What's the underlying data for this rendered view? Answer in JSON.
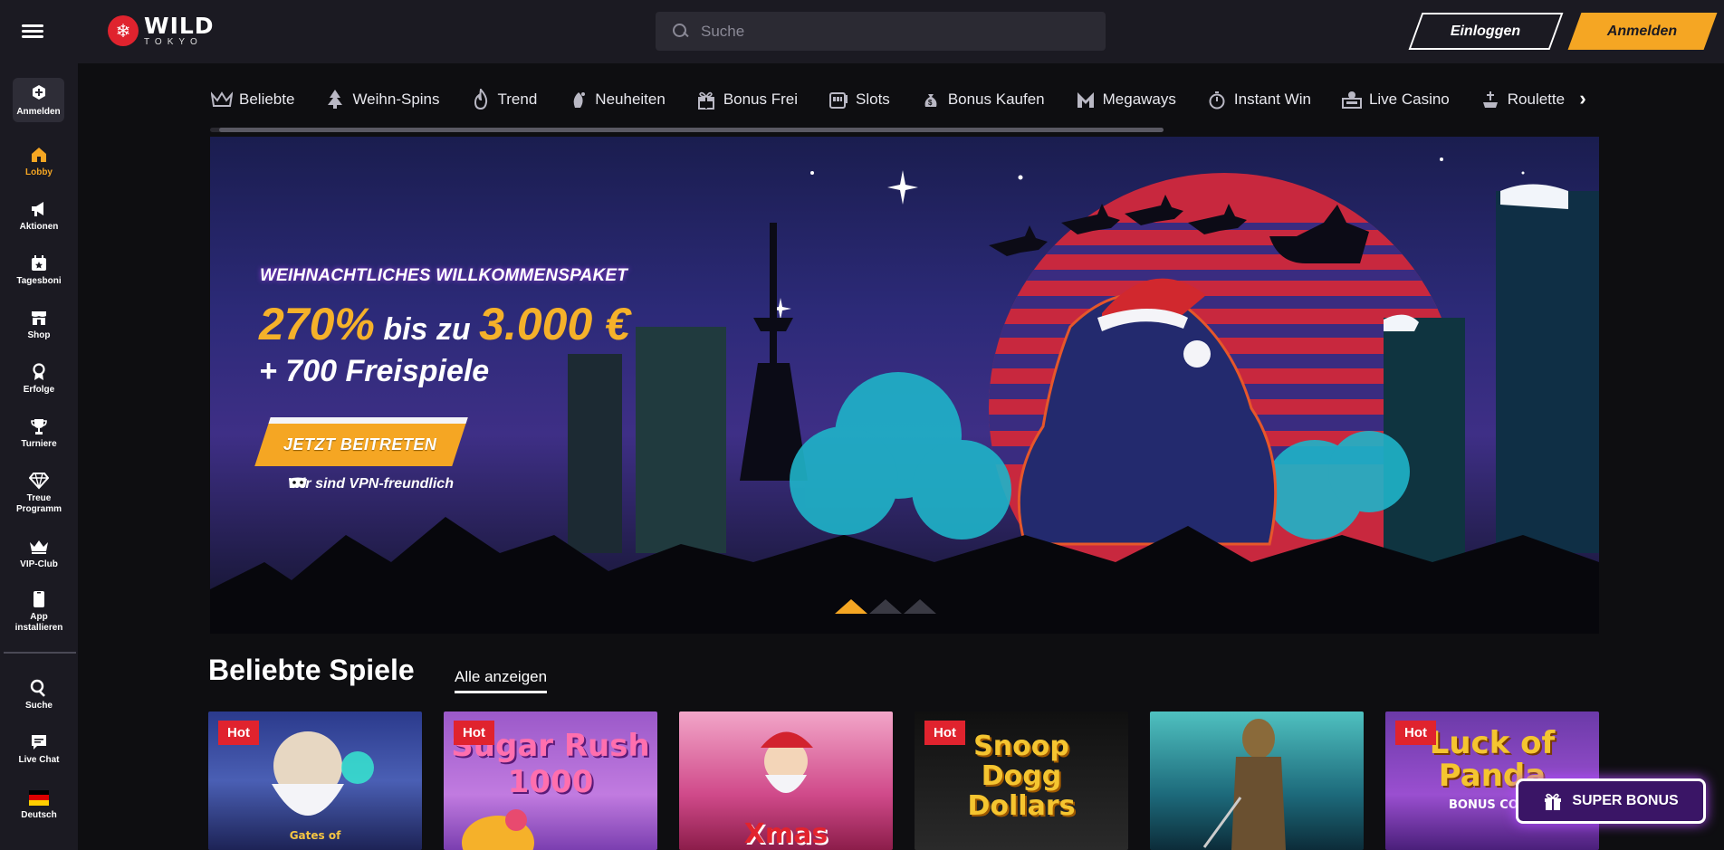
{
  "header": {
    "logo_main": "WILD",
    "logo_sub": "TOKYO",
    "search_placeholder": "Suche",
    "login_label": "Einloggen",
    "register_label": "Anmelden"
  },
  "sidebar": {
    "register_label": "Anmelden",
    "items": [
      {
        "label": "Lobby",
        "icon": "home-icon",
        "active": true
      },
      {
        "label": "Aktionen",
        "icon": "megaphone-icon"
      },
      {
        "label": "Tagesboni",
        "icon": "calendar-star-icon"
      },
      {
        "label": "Shop",
        "icon": "shop-icon"
      },
      {
        "label": "Erfolge",
        "icon": "medal-icon"
      },
      {
        "label": "Turniere",
        "icon": "trophy-icon"
      },
      {
        "label": "Treue Programm",
        "icon": "diamond-icon"
      },
      {
        "label": "VIP-Club",
        "icon": "crown-icon"
      },
      {
        "label": "App installieren",
        "icon": "phone-icon"
      },
      {
        "label": "Suche",
        "icon": "search-icon"
      },
      {
        "label": "Live Chat",
        "icon": "chat-icon"
      },
      {
        "label": "Deutsch",
        "icon": "flag-de-icon"
      }
    ]
  },
  "categories": [
    {
      "label": "Beliebte",
      "icon": "crown-outline-icon"
    },
    {
      "label": "Weihn-Spins",
      "icon": "christmas-tree-icon"
    },
    {
      "label": "Trend",
      "icon": "flame-icon"
    },
    {
      "label": "Neuheiten",
      "icon": "sparkle-icon"
    },
    {
      "label": "Bonus Frei",
      "icon": "gift-icon"
    },
    {
      "label": "Slots",
      "icon": "slot-machine-icon"
    },
    {
      "label": "Bonus Kaufen",
      "icon": "money-bag-icon"
    },
    {
      "label": "Megaways",
      "icon": "megaways-icon"
    },
    {
      "label": "Instant Win",
      "icon": "stopwatch-icon"
    },
    {
      "label": "Live Casino",
      "icon": "live-dealer-icon"
    },
    {
      "label": "Roulette",
      "icon": "roulette-icon"
    }
  ],
  "banner": {
    "subtitle": "WEIHNACHTLICHES WILLKOMMENSPAKET",
    "percent": "270%",
    "middle": " bis zu ",
    "amount": "3.000 €",
    "free_spins": "+ 700 Freispiele",
    "cta": "JETZT BEITRETEN",
    "vpn": "Wir sind VPN-freundlich"
  },
  "section": {
    "title": "Beliebte Spiele",
    "view_all": "Alle anzeigen"
  },
  "games": [
    {
      "badge": "Hot",
      "title": "Gates of"
    },
    {
      "badge": "Hot",
      "title": "Sugar Rush 1000"
    },
    {
      "badge": "",
      "title": "Xmas"
    },
    {
      "badge": "Hot",
      "title": "Snoop Dogg Dollars"
    },
    {
      "badge": "",
      "title": ""
    },
    {
      "badge": "Hot",
      "title": "Luck of Panda",
      "subtitle": "BONUS CO"
    }
  ],
  "super_bonus": "SUPER BONUS",
  "colors": {
    "accent": "#f5a623",
    "hot": "#e0232e",
    "background": "#0e0e11",
    "panel": "#1b1a22"
  }
}
